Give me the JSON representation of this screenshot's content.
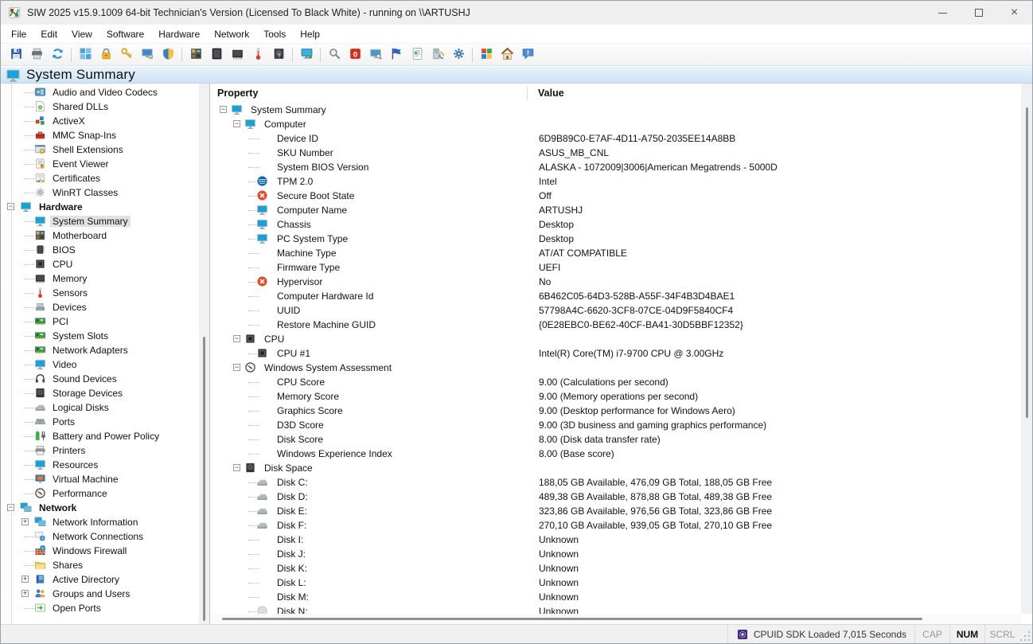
{
  "window": {
    "title": "SIW 2025 v15.9.1009 64-bit Technician's Version (Licensed To Black White) - running on \\\\ARTUSHJ",
    "app_icon": "siw-logo",
    "controls": {
      "minimize": "minimize",
      "maximize": "maximize",
      "close": "close"
    }
  },
  "menu": {
    "items": [
      "File",
      "Edit",
      "View",
      "Software",
      "Hardware",
      "Network",
      "Tools",
      "Help"
    ]
  },
  "toolbar": {
    "groups": [
      [
        {
          "name": "save",
          "icon": "save"
        },
        {
          "name": "print",
          "icon": "print"
        },
        {
          "name": "refresh",
          "icon": "refresh"
        }
      ],
      [
        {
          "name": "software",
          "icon": "window4"
        },
        {
          "name": "licenses",
          "icon": "lock"
        },
        {
          "name": "passwords",
          "icon": "key"
        },
        {
          "name": "windows-settings",
          "icon": "monitor-gear"
        },
        {
          "name": "security",
          "icon": "shield"
        }
      ],
      [
        {
          "name": "motherboard",
          "icon": "motherboard"
        },
        {
          "name": "monitor-info",
          "icon": "lcd"
        },
        {
          "name": "memory",
          "icon": "memory"
        },
        {
          "name": "sensors",
          "icon": "thermometer"
        },
        {
          "name": "storage",
          "icon": "hdd-q"
        }
      ],
      [
        {
          "name": "network",
          "icon": "net-monitor"
        }
      ],
      [
        {
          "name": "eureka",
          "icon": "magnifier"
        },
        {
          "name": "shutdown",
          "icon": "red-zero"
        },
        {
          "name": "remote",
          "icon": "monitor-search"
        },
        {
          "name": "ping",
          "icon": "flag"
        },
        {
          "name": "report",
          "icon": "document"
        },
        {
          "name": "sync",
          "icon": "server-sync"
        },
        {
          "name": "options",
          "icon": "gear"
        }
      ],
      [
        {
          "name": "updates",
          "icon": "app"
        },
        {
          "name": "home",
          "icon": "home"
        },
        {
          "name": "feedback",
          "icon": "feedback"
        }
      ]
    ]
  },
  "page_header": {
    "title": "System Summary",
    "icon": "monitor"
  },
  "sidebar": {
    "items": [
      {
        "label": "Audio and Video Codecs",
        "icon": "codecs",
        "level": 1
      },
      {
        "label": "Shared DLLs",
        "icon": "dll",
        "level": 1
      },
      {
        "label": "ActiveX",
        "icon": "activex",
        "level": 1
      },
      {
        "label": "MMC Snap-Ins",
        "icon": "mmc",
        "level": 1
      },
      {
        "label": "Shell Extensions",
        "icon": "shellext",
        "level": 1
      },
      {
        "label": "Event Viewer",
        "icon": "eventlog",
        "level": 1
      },
      {
        "label": "Certificates",
        "icon": "certificate",
        "level": 1
      },
      {
        "label": "WinRT Classes",
        "icon": "gear-gray",
        "level": 1
      },
      {
        "label": "Hardware",
        "icon": "monitor",
        "level": 0,
        "bold": true,
        "expand": "minus"
      },
      {
        "label": "System Summary",
        "icon": "monitor",
        "level": 1,
        "selected": true
      },
      {
        "label": "Motherboard",
        "icon": "motherboard",
        "level": 1
      },
      {
        "label": "BIOS",
        "icon": "chip",
        "level": 1
      },
      {
        "label": "CPU",
        "icon": "cpu",
        "level": 1
      },
      {
        "label": "Memory",
        "icon": "memory",
        "level": 1
      },
      {
        "label": "Sensors",
        "icon": "thermometer",
        "level": 1
      },
      {
        "label": "Devices",
        "icon": "devices",
        "level": 1
      },
      {
        "label": "PCI",
        "icon": "pcicard",
        "level": 1
      },
      {
        "label": "System Slots",
        "icon": "pcicard",
        "level": 1
      },
      {
        "label": "Network Adapters",
        "icon": "pcicard",
        "level": 1
      },
      {
        "label": "Video",
        "icon": "monitor",
        "level": 1
      },
      {
        "label": "Sound Devices",
        "icon": "headphones",
        "level": 1
      },
      {
        "label": "Storage Devices",
        "icon": "hdd",
        "level": 1
      },
      {
        "label": "Logical Disks",
        "icon": "logicaldisk",
        "level": 1
      },
      {
        "label": "Ports",
        "icon": "port",
        "level": 1
      },
      {
        "label": "Battery and Power Policy",
        "icon": "battery",
        "level": 1
      },
      {
        "label": "Printers",
        "icon": "printer",
        "level": 1
      },
      {
        "label": "Resources",
        "icon": "monitor",
        "level": 1
      },
      {
        "label": "Virtual Machine",
        "icon": "vm",
        "level": 1
      },
      {
        "label": "Performance",
        "icon": "gauge",
        "level": 1
      },
      {
        "label": "Network",
        "icon": "network",
        "level": 0,
        "bold": true,
        "expand": "minus"
      },
      {
        "label": "Network Information",
        "icon": "network",
        "level": 1,
        "expand": "plus"
      },
      {
        "label": "Network Connections",
        "icon": "netconn",
        "level": 1
      },
      {
        "label": "Windows Firewall",
        "icon": "firewall",
        "level": 1
      },
      {
        "label": "Shares",
        "icon": "folder",
        "level": 1
      },
      {
        "label": "Active Directory",
        "icon": "activedir",
        "level": 1,
        "expand": "plus"
      },
      {
        "label": "Groups and Users",
        "icon": "users",
        "level": 1,
        "expand": "plus"
      },
      {
        "label": "Open Ports",
        "icon": "openports",
        "level": 1
      }
    ]
  },
  "content": {
    "columns": {
      "property": "Property",
      "value": "Value"
    },
    "rows": [
      {
        "property": "System Summary",
        "icon": "monitor",
        "level": 0,
        "expand": "minus",
        "value": ""
      },
      {
        "property": "Computer",
        "icon": "monitor",
        "level": 1,
        "expand": "minus",
        "value": ""
      },
      {
        "property": "Device ID",
        "level": 2,
        "value": "6D9B89C0-E7AF-4D11-A750-2035EE14A8BB"
      },
      {
        "property": "SKU Number",
        "level": 2,
        "value": "ASUS_MB_CNL"
      },
      {
        "property": "System BIOS Version",
        "level": 2,
        "value": "ALASKA - 1072009|3006|American Megatrends - 5000D"
      },
      {
        "property": "TPM 2.0",
        "icon": "tpm",
        "level": 2,
        "value": "Intel"
      },
      {
        "property": "Secure Boot State",
        "icon": "redx",
        "level": 2,
        "value": "Off"
      },
      {
        "property": "Computer Name",
        "icon": "monitor",
        "level": 2,
        "value": "ARTUSHJ"
      },
      {
        "property": "Chassis",
        "icon": "monitor",
        "level": 2,
        "value": "Desktop"
      },
      {
        "property": "PC System Type",
        "icon": "monitor",
        "level": 2,
        "value": "Desktop"
      },
      {
        "property": "Machine Type",
        "level": 2,
        "value": "AT/AT COMPATIBLE"
      },
      {
        "property": "Firmware Type",
        "level": 2,
        "value": "UEFI"
      },
      {
        "property": "Hypervisor",
        "icon": "redx",
        "level": 2,
        "value": "No"
      },
      {
        "property": "Computer Hardware Id",
        "level": 2,
        "value": "6B462C05-64D3-528B-A55F-34F4B3D4BAE1"
      },
      {
        "property": "UUID",
        "level": 2,
        "value": "57798A4C-6620-3CF8-07CE-04D9F5840CF4"
      },
      {
        "property": "Restore Machine GUID",
        "level": 2,
        "value": "{0E28EBC0-BE62-40CF-BA41-30D5BBF12352}"
      },
      {
        "property": "CPU",
        "icon": "cpu",
        "level": 1,
        "expand": "minus",
        "value": ""
      },
      {
        "property": "CPU #1",
        "icon": "cpu",
        "level": 2,
        "value": "Intel(R) Core(TM) i7-9700 CPU @ 3.00GHz"
      },
      {
        "property": "Windows System Assessment",
        "icon": "gauge",
        "level": 1,
        "expand": "minus",
        "value": ""
      },
      {
        "property": "CPU Score",
        "level": 2,
        "value": "9.00 (Calculations per second)"
      },
      {
        "property": "Memory Score",
        "level": 2,
        "value": "9.00 (Memory operations per second)"
      },
      {
        "property": "Graphics Score",
        "level": 2,
        "value": "9.00 (Desktop performance for Windows Aero)"
      },
      {
        "property": "D3D Score",
        "level": 2,
        "value": "9.00 (3D business and gaming graphics performance)"
      },
      {
        "property": "Disk Score",
        "level": 2,
        "value": "8.00 (Disk data transfer rate)"
      },
      {
        "property": "Windows Experience Index",
        "level": 2,
        "value": "8.00 (Base score)"
      },
      {
        "property": "Disk Space",
        "icon": "hdd",
        "level": 1,
        "expand": "minus",
        "value": ""
      },
      {
        "property": "Disk C:",
        "icon": "logicaldisk",
        "level": 2,
        "value": "188,05 GB Available, 476,09 GB Total, 188,05 GB Free"
      },
      {
        "property": "Disk D:",
        "icon": "logicaldisk",
        "level": 2,
        "value": "489,38 GB Available, 878,88 GB Total, 489,38 GB Free"
      },
      {
        "property": "Disk E:",
        "icon": "logicaldisk",
        "level": 2,
        "value": "323,86 GB Available, 976,56 GB Total, 323,86 GB Free"
      },
      {
        "property": "Disk F:",
        "icon": "logicaldisk",
        "level": 2,
        "value": "270,10 GB Available, 939,05 GB Total, 270,10 GB Free"
      },
      {
        "property": "Disk I:",
        "level": 2,
        "value": "Unknown"
      },
      {
        "property": "Disk J:",
        "level": 2,
        "value": "Unknown"
      },
      {
        "property": "Disk K:",
        "level": 2,
        "value": "Unknown"
      },
      {
        "property": "Disk L:",
        "level": 2,
        "value": "Unknown"
      },
      {
        "property": "Disk M:",
        "level": 2,
        "value": "Unknown"
      },
      {
        "property": "Disk N:",
        "icon": "cd",
        "level": 2,
        "value": "Unknown"
      }
    ]
  },
  "status_bar": {
    "message": "CPUID SDK Loaded 7,015 Seconds",
    "icon": "cpuid",
    "indicators": [
      {
        "label": "CAP",
        "active": false
      },
      {
        "label": "NUM",
        "active": true
      },
      {
        "label": "SCRL",
        "active": false
      }
    ]
  },
  "colors": {
    "header_band": "#d9e9f8",
    "selection": "#e2e2e2",
    "accent_blue": "#1ba1d6"
  }
}
